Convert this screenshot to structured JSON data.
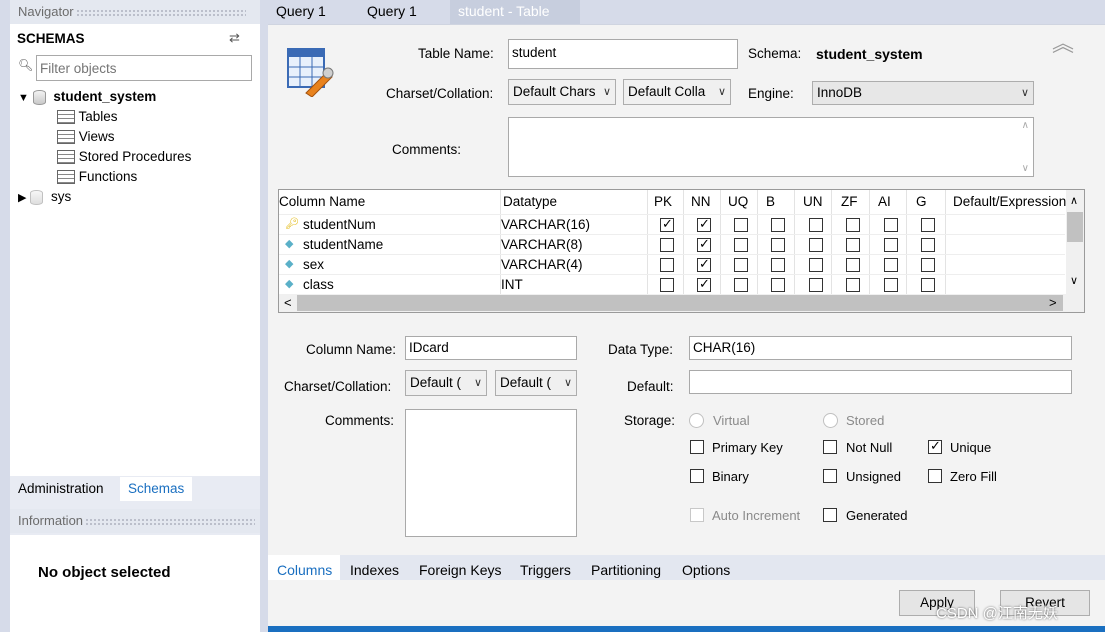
{
  "navigator": {
    "title": "Navigator",
    "schemas_label": "SCHEMAS",
    "filter_placeholder": "Filter objects",
    "tree": {
      "db1": "student_system",
      "children": [
        "Tables",
        "Views",
        "Stored Procedures",
        "Functions"
      ],
      "db2": "sys"
    },
    "tabs": [
      "Administration",
      "Schemas"
    ],
    "info_title": "Information",
    "info_text": "No object selected"
  },
  "tabs": [
    "Query 1",
    "Query 1",
    "student - Table"
  ],
  "table_form": {
    "table_name_label": "Table Name:",
    "table_name": "student",
    "schema_label": "Schema:",
    "schema": "student_system",
    "charset_label": "Charset/Collation:",
    "charset": "Default Chars",
    "collation": "Default Colla",
    "engine_label": "Engine:",
    "engine": "InnoDB",
    "comments_label": "Comments:"
  },
  "grid": {
    "headers": [
      "Column Name",
      "Datatype",
      "PK",
      "NN",
      "UQ",
      "B",
      "UN",
      "ZF",
      "AI",
      "G",
      "Default/Expression"
    ],
    "rows": [
      {
        "name": "studentNum",
        "type": "VARCHAR(16)",
        "flags": [
          1,
          1,
          0,
          0,
          0,
          0,
          0,
          0
        ],
        "pk": true
      },
      {
        "name": "studentName",
        "type": "VARCHAR(8)",
        "flags": [
          0,
          1,
          0,
          0,
          0,
          0,
          0,
          0
        ],
        "pk": false
      },
      {
        "name": "sex",
        "type": "VARCHAR(4)",
        "flags": [
          0,
          1,
          0,
          0,
          0,
          0,
          0,
          0
        ],
        "pk": false
      },
      {
        "name": "class",
        "type": "INT",
        "flags": [
          0,
          1,
          0,
          0,
          0,
          0,
          0,
          0
        ],
        "pk": false
      }
    ]
  },
  "column_form": {
    "column_name_label": "Column Name:",
    "column_name": "IDcard",
    "data_type_label": "Data Type:",
    "data_type": "CHAR(16)",
    "charset_label": "Charset/Collation:",
    "charset": "Default (",
    "collation": "Default (",
    "default_label": "Default:",
    "comments_label": "Comments:",
    "storage_label": "Storage:",
    "virtual": "Virtual",
    "stored": "Stored",
    "primary_key": "Primary Key",
    "not_null": "Not Null",
    "unique": "Unique",
    "binary": "Binary",
    "unsigned": "Unsigned",
    "zero_fill": "Zero Fill",
    "auto_increment": "Auto Increment",
    "generated": "Generated"
  },
  "bottom_tabs": [
    "Columns",
    "Indexes",
    "Foreign Keys",
    "Triggers",
    "Partitioning",
    "Options"
  ],
  "buttons": {
    "apply": "Apply",
    "revert": "Revert"
  },
  "watermark": "CSDN @江南无妖",
  "colors": {
    "accent": "#1a6fc0",
    "active_tab": "#c7cede"
  }
}
